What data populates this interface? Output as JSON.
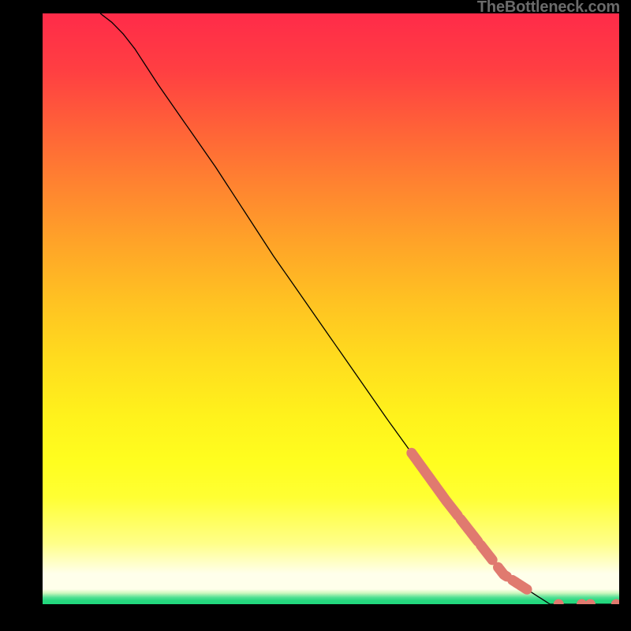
{
  "attribution": "TheBottleneck.com",
  "chart_data": {
    "type": "line",
    "title": "",
    "xlabel": "",
    "ylabel": "",
    "xlim": [
      0,
      100
    ],
    "ylim": [
      0,
      100
    ],
    "grid": false,
    "legend": false,
    "curve": {
      "x": [
        10,
        12,
        14,
        16,
        20,
        30,
        40,
        50,
        60,
        70,
        80,
        88,
        92,
        96,
        100
      ],
      "y": [
        100,
        98.5,
        96.5,
        94,
        88,
        74,
        59,
        45,
        31,
        17.5,
        5,
        0,
        0,
        0,
        0
      ]
    },
    "highlight_segments": [
      {
        "x_start": 64,
        "x_end": 72,
        "type": "on_curve"
      },
      {
        "x_start": 72.5,
        "x_end": 75.5,
        "type": "on_curve"
      },
      {
        "x_start": 76,
        "x_end": 78,
        "type": "on_curve"
      },
      {
        "x_start": 79,
        "x_end": 80.5,
        "type": "on_curve"
      },
      {
        "x_start": 81.5,
        "x_end": 84,
        "type": "on_curve"
      }
    ],
    "highlight_points_on_baseline": [
      89.5,
      93.5,
      95,
      99.5
    ],
    "colors": {
      "curve": "#000000",
      "highlight": "#e07a6f",
      "gradient_top": "#ff2b49",
      "gradient_mid": "#ffe31f",
      "gradient_bottom": "#1fd87d",
      "background_outside": "#000000"
    }
  }
}
